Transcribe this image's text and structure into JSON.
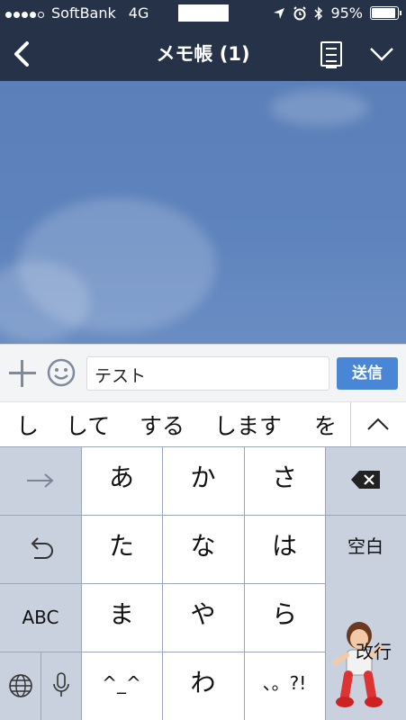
{
  "status_bar": {
    "carrier": "SoftBank",
    "network": "4G",
    "battery": "95%",
    "battery_level": 0.95
  },
  "header": {
    "title": "メモ帳 (1)"
  },
  "input_bar": {
    "message": "テスト",
    "send_label": "送信"
  },
  "suggestions": [
    "し",
    "して",
    "する",
    "します",
    "を"
  ],
  "keyboard": {
    "row1": [
      "あ",
      "か",
      "さ"
    ],
    "row2": [
      "た",
      "な",
      "は"
    ],
    "row3": [
      "ま",
      "や",
      "ら"
    ],
    "row4": [
      "^_^",
      "わ",
      "、。?!"
    ],
    "abc_label": "ABC",
    "space_label": "空白",
    "return_label": "改行"
  },
  "colors": {
    "header": "#263248",
    "send_button": "#4a86d6",
    "chat_background": "#5f84bd"
  }
}
